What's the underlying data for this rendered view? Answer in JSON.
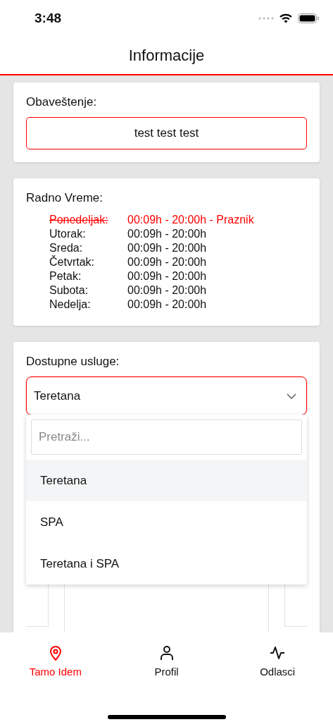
{
  "status_bar": {
    "time": "3:48"
  },
  "header": {
    "title": "Informacije"
  },
  "notice": {
    "label": "Obaveštenje:",
    "text": "test test test"
  },
  "hours": {
    "label": "Radno Vreme:",
    "days": [
      {
        "day": "Ponedeljak:",
        "hours": "00:09h - 20:00h - Praznik",
        "holiday": true
      },
      {
        "day": "Utorak:",
        "hours": "00:09h - 20:00h",
        "holiday": false
      },
      {
        "day": "Sreda:",
        "hours": "00:09h - 20:00h",
        "holiday": false
      },
      {
        "day": "Četvrtak:",
        "hours": "00:09h - 20:00h",
        "holiday": false
      },
      {
        "day": "Petak:",
        "hours": "00:09h - 20:00h",
        "holiday": false
      },
      {
        "day": "Subota:",
        "hours": "00:09h - 20:00h",
        "holiday": false
      },
      {
        "day": "Nedelja:",
        "hours": "00:09h - 20:00h",
        "holiday": false
      }
    ]
  },
  "services": {
    "label": "Dostupne usluge:",
    "value": "Teretana",
    "expanded": true,
    "search": {
      "placeholder": "Pretraži..."
    },
    "options": [
      {
        "label": "Teretana",
        "selected": true
      },
      {
        "label": "SPA",
        "selected": false
      },
      {
        "label": "Teretana i SPA",
        "selected": false
      }
    ]
  },
  "tab_bar": [
    {
      "label": "Tamo Idem",
      "kind": "pin",
      "selected": true
    },
    {
      "label": "Profil",
      "kind": "person",
      "selected": false
    },
    {
      "label": "Odlasci",
      "kind": "pulse",
      "selected": false
    }
  ]
}
